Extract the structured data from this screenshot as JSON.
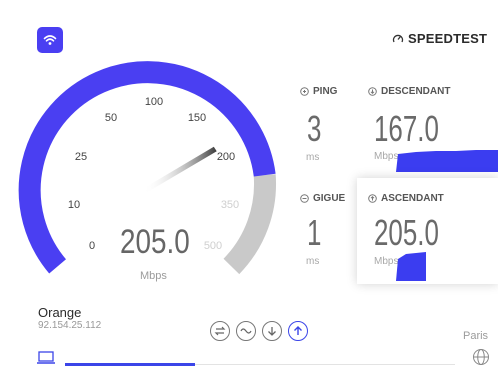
{
  "brand": {
    "name": "SPEEDTEST",
    "icon": "speedometer-icon"
  },
  "gauge": {
    "tick_labels": [
      "0",
      "10",
      "25",
      "50",
      "100",
      "150",
      "200",
      "350",
      "500"
    ],
    "value": "205.0",
    "unit": "Mbps",
    "colors": {
      "filled": "#4a3ff2",
      "remaining": "#c9c9c9"
    }
  },
  "metrics": {
    "ping": {
      "label": "PING",
      "value": "3",
      "unit": "ms"
    },
    "download": {
      "label": "DESCENDANT",
      "value": "167.0",
      "unit": "Mbps"
    },
    "jitter": {
      "label": "GIGUE",
      "value": "1",
      "unit": "ms"
    },
    "upload": {
      "label": "ASCENDANT",
      "value": "205.0",
      "unit": "Mbps"
    }
  },
  "isp": {
    "name": "Orange",
    "ip": "92.154.25.112"
  },
  "server": {
    "location": "Paris"
  },
  "controls": [
    "connections-icon",
    "wave-icon",
    "download-arrow-icon",
    "upload-arrow-icon"
  ],
  "accent": "#3b45e8"
}
